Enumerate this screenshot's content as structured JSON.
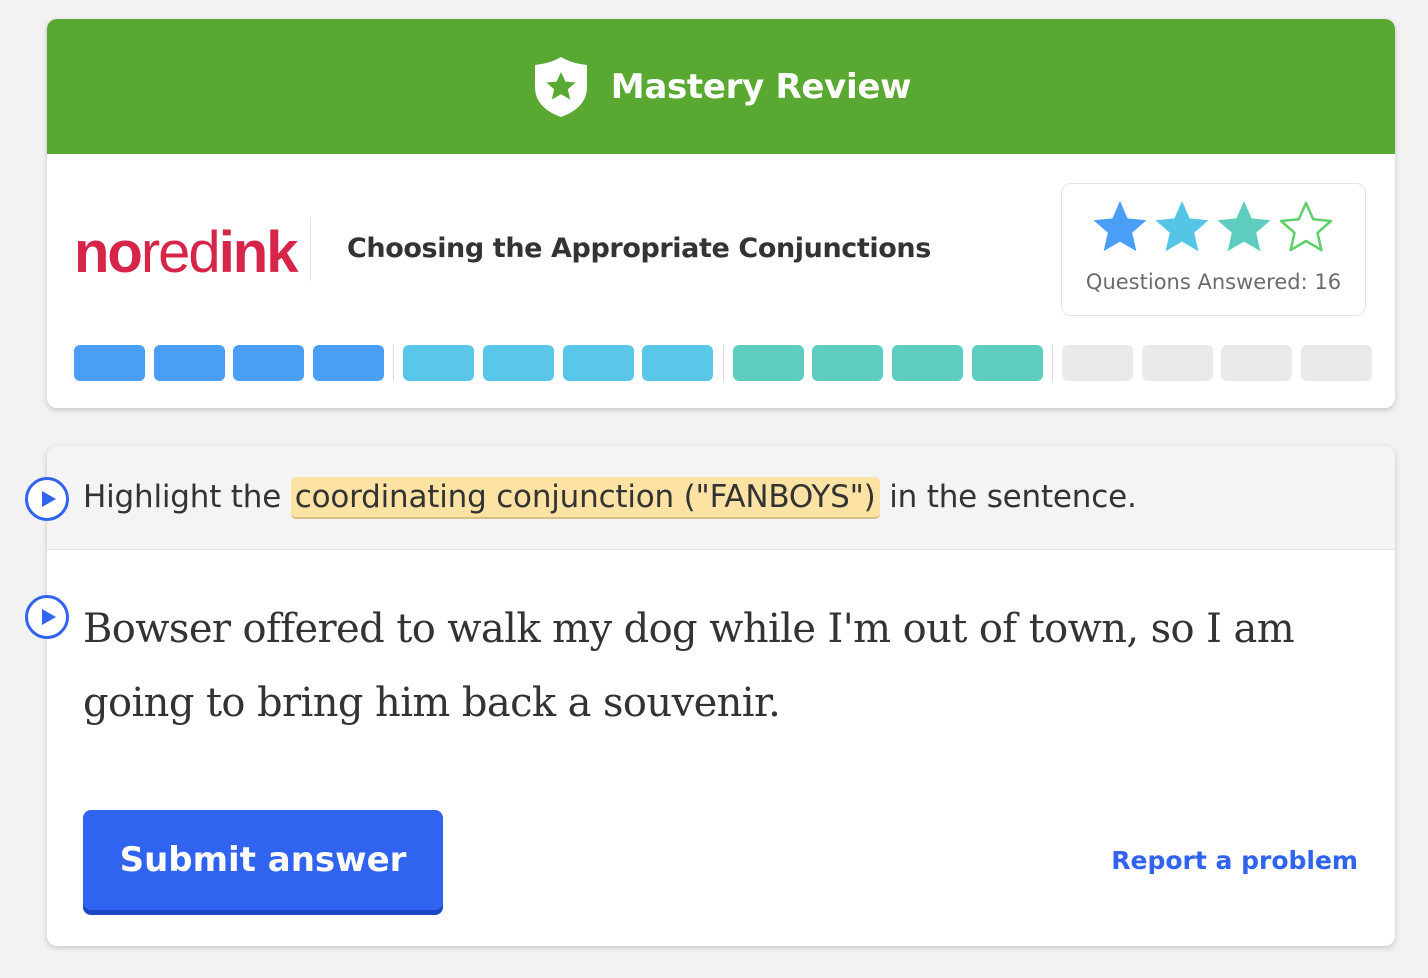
{
  "banner": {
    "title": "Mastery Review",
    "icon": "shield-star-icon",
    "color": "#58a832"
  },
  "brand": {
    "logo_bold_1": "no",
    "logo_light": "red",
    "logo_bold_2": "ink",
    "color": "#d5264a"
  },
  "topic": {
    "title": "Choosing the Appropriate Conjunctions"
  },
  "stars": {
    "filled": 3,
    "total": 4,
    "colors": [
      "#4a9ef6",
      "#55c5e6",
      "#5ecdc0",
      "#5ed06a"
    ],
    "questions_answered_label": "Questions Answered: 16"
  },
  "progress": {
    "groups": [
      {
        "color": "#4a9ef6",
        "completed": 4,
        "total": 4
      },
      {
        "color": "#5ac6e8",
        "completed": 4,
        "total": 4
      },
      {
        "color": "#5ecdc0",
        "completed": 4,
        "total": 4
      },
      {
        "color": "#eaeaea",
        "completed": 0,
        "total": 4
      }
    ]
  },
  "question": {
    "prompt_before": "Highlight the",
    "prompt_highlight": "coordinating conjunction (\"FANBOYS\")",
    "prompt_after": "in the sentence.",
    "sentence": "Bowser offered to walk my dog while I'm out of town, so I am going to bring him back a souvenir."
  },
  "actions": {
    "submit_label": "Submit answer",
    "report_label": "Report a problem",
    "accent": "#2f63f0"
  }
}
